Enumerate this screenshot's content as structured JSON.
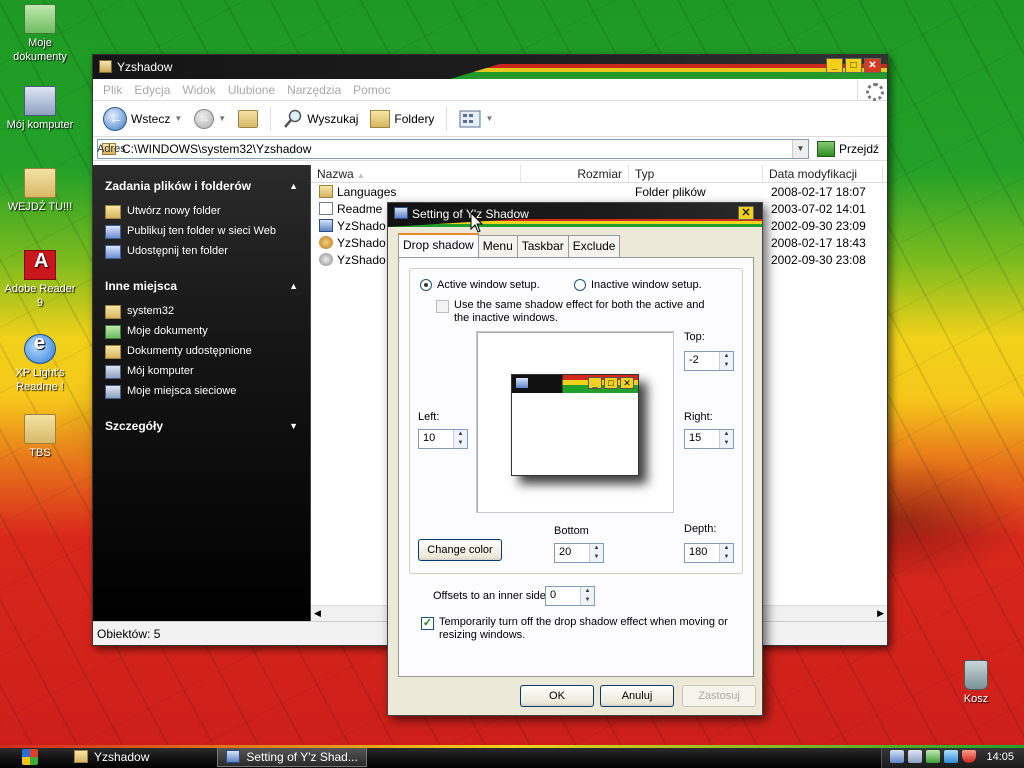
{
  "desktop": {
    "icons": [
      {
        "label": "Moje dokumenty",
        "icon": "folder-icon"
      },
      {
        "label": "Mój komputer",
        "icon": "computer-icon"
      },
      {
        "label": "WEJDŹ TU!!!",
        "icon": "folder-icon"
      },
      {
        "label": "Adobe Reader 9",
        "icon": "pdf-icon"
      },
      {
        "label": "XP Light's Readme !",
        "icon": "ie-icon"
      },
      {
        "label": "TBS",
        "icon": "folder-icon"
      },
      {
        "label": "Kosz",
        "icon": "recycle-bin-icon"
      }
    ]
  },
  "explorer": {
    "title": "Yzshadow",
    "menu": [
      "Plik",
      "Edycja",
      "Widok",
      "Ulubione",
      "Narzędzia",
      "Pomoc"
    ],
    "toolbar": {
      "back": "Wstecz",
      "search": "Wyszukaj",
      "folders": "Foldery"
    },
    "address": {
      "label": "Adres",
      "value": "C:\\WINDOWS\\system32\\Yzshadow",
      "go": "Przejdź"
    },
    "taskpane": {
      "tasks_title": "Zadania plików i folderów",
      "tasks": [
        "Utwórz nowy folder",
        "Publikuj ten folder w sieci Web",
        "Udostępnij ten folder"
      ],
      "places_title": "Inne miejsca",
      "places": [
        "system32",
        "Moje dokumenty",
        "Dokumenty udostępnione",
        "Mój komputer",
        "Moje miejsca sieciowe"
      ],
      "details_title": "Szczegóły"
    },
    "columns": [
      "Nazwa",
      "Rozmiar",
      "Typ",
      "Data modyfikacji"
    ],
    "files": [
      {
        "name": "Languages",
        "size": "",
        "type": "Folder plików",
        "date": "2008-02-17 18:07"
      },
      {
        "name": "Readme",
        "size": "",
        "type": "",
        "date": "2003-07-02 14:01"
      },
      {
        "name": "YzShado",
        "size": "",
        "type": "",
        "date": "2002-09-30 23:09"
      },
      {
        "name": "YzShado",
        "size": "",
        "type": "",
        "date": "2008-02-17 18:43"
      },
      {
        "name": "YzShado",
        "size": "",
        "type": "",
        "date": "2002-09-30 23:08"
      }
    ],
    "status": "Obiektów: 5"
  },
  "dialog": {
    "title": "Setting of Y'z Shadow",
    "tabs": [
      "Drop shadow",
      "Menu",
      "Taskbar",
      "Exclude"
    ],
    "active_window": "Active window setup.",
    "inactive_window": "Inactive window setup.",
    "same_effect": "Use the same shadow effect for both the active and the inactive windows.",
    "top_label": "Top:",
    "top_value": "-2",
    "left_label": "Left:",
    "left_value": "10",
    "right_label": "Right:",
    "right_value": "15",
    "bottom_label": "Bottom",
    "bottom_value": "20",
    "depth_label": "Depth:",
    "depth_value": "180",
    "change_color": "Change color",
    "offsets_label": "Offsets to an inner side:",
    "offsets_value": "0",
    "temp_off": "Temporarily turn off the drop shadow effect when moving or resizing windows.",
    "ok": "OK",
    "cancel": "Anuluj",
    "apply": "Zastosuj"
  },
  "taskbar": {
    "items": [
      "Yzshadow",
      "Setting of Y'z Shad..."
    ],
    "clock": "14:05"
  }
}
